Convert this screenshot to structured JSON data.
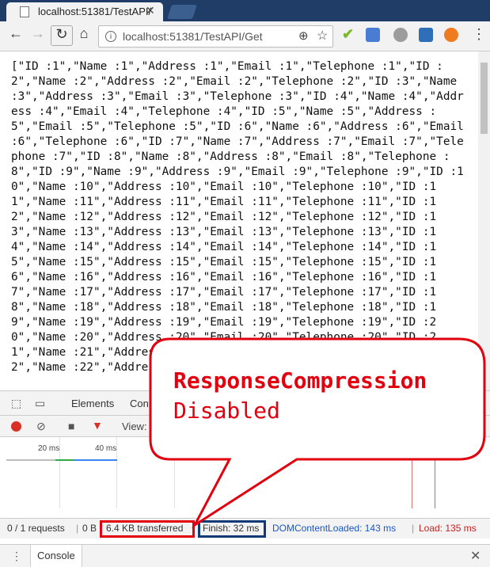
{
  "browser": {
    "tab_title": "localhost:51381/TestAPI/",
    "url": "localhost:51381/TestAPI/Get"
  },
  "response_body": "[\"ID :1\",\"Name :1\",\"Address :1\",\"Email :1\",\"Telephone :1\",\"ID :2\",\"Name :2\",\"Address :2\",\"Email :2\",\"Telephone :2\",\"ID :3\",\"Name :3\",\"Address :3\",\"Email :3\",\"Telephone :3\",\"ID :4\",\"Name :4\",\"Address :4\",\"Email :4\",\"Telephone :4\",\"ID :5\",\"Name :5\",\"Address :5\",\"Email :5\",\"Telephone :5\",\"ID :6\",\"Name :6\",\"Address :6\",\"Email :6\",\"Telephone :6\",\"ID :7\",\"Name :7\",\"Address :7\",\"Email :7\",\"Telephone :7\",\"ID :8\",\"Name :8\",\"Address :8\",\"Email :8\",\"Telephone :8\",\"ID :9\",\"Name :9\",\"Address :9\",\"Email :9\",\"Telephone :9\",\"ID :10\",\"Name :10\",\"Address :10\",\"Email :10\",\"Telephone :10\",\"ID :11\",\"Name :11\",\"Address :11\",\"Email :11\",\"Telephone :11\",\"ID :12\",\"Name :12\",\"Address :12\",\"Email :12\",\"Telephone :12\",\"ID :13\",\"Name :13\",\"Address :13\",\"Email :13\",\"Telephone :13\",\"ID :14\",\"Name :14\",\"Address :14\",\"Email :14\",\"Telephone :14\",\"ID :15\",\"Name :15\",\"Address :15\",\"Email :15\",\"Telephone :15\",\"ID :16\",\"Name :16\",\"Address :16\",\"Email :16\",\"Telephone :16\",\"ID :17\",\"Name :17\",\"Address :17\",\"Email :17\",\"Telephone :17\",\"ID :18\",\"Name :18\",\"Address :18\",\"Email :18\",\"Telephone :18\",\"ID :19\",\"Name :19\",\"Address :19\",\"Email :19\",\"Telephone :19\",\"ID :20\",\"Name :20\",\"Address :20\",\"Email :20\",\"Telephone :20\",\"ID :21\",\"Name :21\",\"Address :21\",\"Email :21\",\"Telephone :21\",\"ID :22\",\"Name :22\",\"Address :22\",\"Email :22\",\"Telephone :22\",",
  "devtools": {
    "tabs": [
      "Elements",
      "Con"
    ],
    "view_label": "View:",
    "timeline_ticks": [
      "20 ms",
      "40 ms",
      "60"
    ],
    "summary": {
      "requests": "0 / 1 requests",
      "bytes": "0 B",
      "transferred": "6.4 KB transferred",
      "finish": "Finish: 32 ms",
      "dom_content_loaded": "DOMContentLoaded: 143 ms",
      "load": "Load: 135 ms"
    },
    "drawer_tab": "Console"
  },
  "callout": {
    "line1": "ResponseCompression",
    "line2": "Disabled"
  },
  "colors": {
    "annotation_red": "#e2000f",
    "annotation_blue": "#0e3a78",
    "dom_content_loaded": "#1a57c7",
    "load": "#c5221f"
  }
}
